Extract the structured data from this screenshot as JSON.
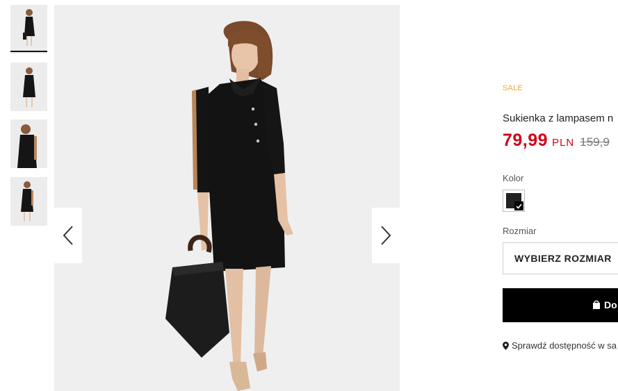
{
  "gallery": {
    "thumbnails": [
      {
        "alt": "product-photo-1",
        "active": true
      },
      {
        "alt": "product-photo-2",
        "active": false
      },
      {
        "alt": "product-photo-3",
        "active": false
      },
      {
        "alt": "product-photo-4",
        "active": false
      }
    ],
    "prev_icon": "chevron-left-icon",
    "next_icon": "chevron-right-icon"
  },
  "product": {
    "badge": "SALE",
    "title": "Sukienka z lampasem n",
    "price": "79,99",
    "currency": "PLN",
    "old_price": "159,9",
    "color_label": "Kolor",
    "size_label": "Rozmiar",
    "size_placeholder": "WYBIERZ ROZMIAR",
    "add_to_cart": "Do",
    "store_check": "Sprawdź dostępność w sa"
  },
  "colors": {
    "sale": "#f0a92b",
    "price": "#d0021b",
    "button": "#000000",
    "swatch": "#222222"
  }
}
